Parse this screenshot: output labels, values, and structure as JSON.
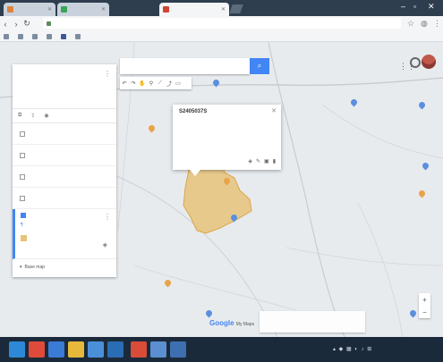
{
  "tabs": [
    {
      "title": "",
      "color": "#e0823c"
    },
    {
      "title": "",
      "color": "#3aa655"
    },
    {
      "title": "",
      "color": "#d04437",
      "active": true
    }
  ],
  "toolbar": {
    "url": ""
  },
  "bookmarks": [
    {
      "label": ""
    },
    {
      "label": ""
    },
    {
      "label": ""
    },
    {
      "label": ""
    },
    {
      "label": ""
    },
    {
      "label": ""
    }
  ],
  "panel": {
    "title": "",
    "subtitle": "",
    "views": "",
    "actions": [
      {
        "icon": "add-layer-icon",
        "label": ""
      },
      {
        "icon": "share-icon",
        "label": ""
      },
      {
        "icon": "preview-icon",
        "label": ""
      }
    ],
    "layers": [
      {
        "label": ""
      },
      {
        "label": ""
      },
      {
        "label": ""
      },
      {
        "label": ""
      }
    ],
    "selected_layer": {
      "name": "",
      "style_link": "",
      "feature": ""
    },
    "base_map": "Base map"
  },
  "search": {
    "placeholder": ""
  },
  "popup": {
    "title": "S2405037S",
    "line1": "",
    "line2": "",
    "footer": ""
  },
  "map_labels": [
    {
      "text": ""
    },
    {
      "text": ""
    },
    {
      "text": ""
    },
    {
      "text": ""
    },
    {
      "text": ""
    },
    {
      "text": ""
    }
  ],
  "bottom": {
    "google_logo": "Google",
    "google_suffix": "My Maps",
    "mini_popup": "",
    "attribution": ""
  },
  "taskbar": {
    "time": "",
    "date": ""
  },
  "colors": {
    "accent": "#4285f4",
    "polygon_fill": "#e8c37a",
    "polygon_stroke": "#d9a74a"
  }
}
